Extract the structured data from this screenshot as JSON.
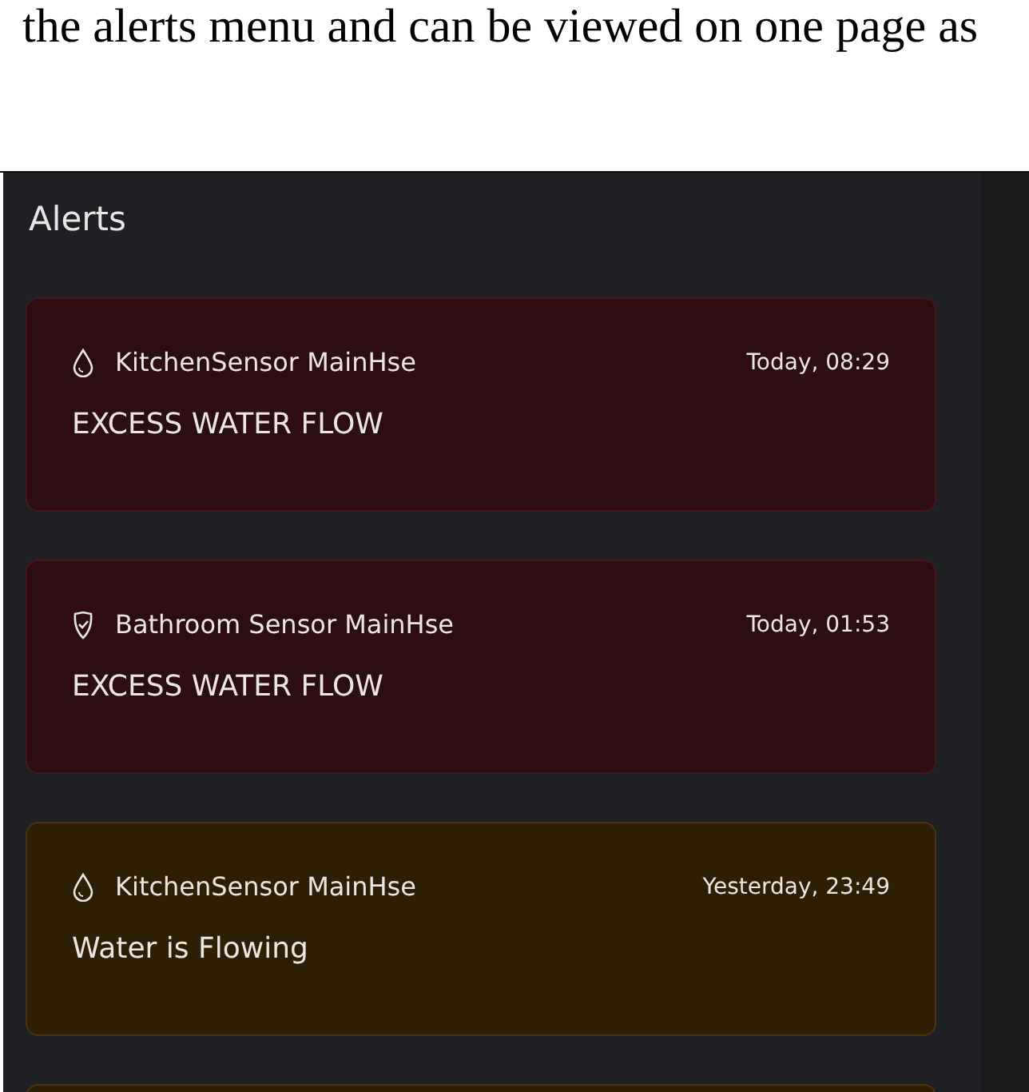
{
  "document_text": "the alerts menu and can be viewed on one page as",
  "panel": {
    "title": "Alerts"
  },
  "alerts": [
    {
      "kind": "critical",
      "sensor": {
        "kind": "drop",
        "label": "KitchenSensor MainHse"
      },
      "time": "Today, 08:29",
      "message": "EXCESS WATER FLOW"
    },
    {
      "kind": "critical",
      "sensor": {
        "kind": "shield",
        "label": "Bathroom Sensor MainHse"
      },
      "time": "Today, 01:53",
      "message": "EXCESS WATER FLOW"
    },
    {
      "kind": "warning",
      "sensor": {
        "kind": "drop",
        "label": "KitchenSensor MainHse"
      },
      "time": "Yesterday, 23:49",
      "message": "Water is Flowing"
    },
    {
      "kind": "warning"
    }
  ]
}
